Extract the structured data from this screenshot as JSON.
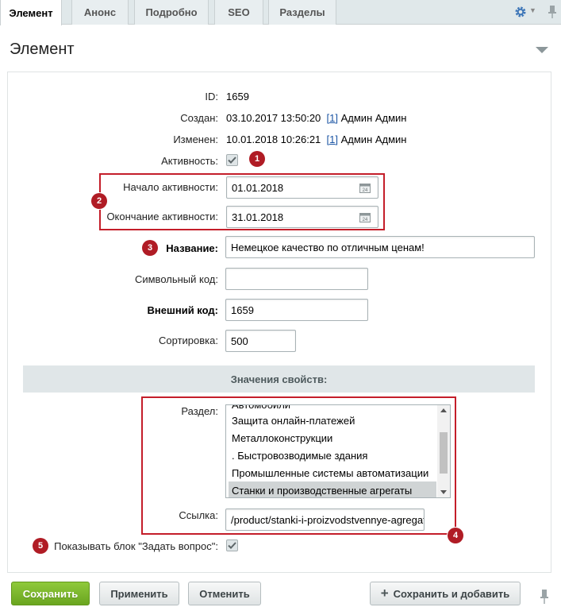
{
  "tabs": [
    {
      "label": "Элемент",
      "active": true
    },
    {
      "label": "Анонс",
      "active": false
    },
    {
      "label": "Подробно",
      "active": false
    },
    {
      "label": "SEO",
      "active": false
    },
    {
      "label": "Разделы",
      "active": false
    }
  ],
  "section_title": "Элемент",
  "fields": {
    "id": {
      "label": "ID:",
      "value": "1659"
    },
    "created": {
      "label": "Создан:",
      "value": "03.10.2017 13:50:20",
      "user_link": "[1]",
      "user_name": "Админ Админ"
    },
    "modified": {
      "label": "Изменен:",
      "value": "10.01.2018 10:26:21",
      "user_link": "[1]",
      "user_name": "Админ Админ"
    },
    "active": {
      "label": "Активность:",
      "checked": true
    },
    "active_from": {
      "label": "Начало активности:",
      "value": "01.01.2018"
    },
    "active_to": {
      "label": "Окончание активности:",
      "value": "31.01.2018"
    },
    "name": {
      "label": "Название:",
      "value": "Немецкое качество по отличным ценам!"
    },
    "code": {
      "label": "Символьный код:",
      "value": ""
    },
    "xml_id": {
      "label": "Внешний код:",
      "value": "1659"
    },
    "sort": {
      "label": "Сортировка:",
      "value": "500"
    }
  },
  "properties": {
    "header": "Значения свойств:",
    "section_label": "Раздел:",
    "section_options": [
      "Автомобили",
      "Защита онлайн-платежей",
      "Металлоконструкции",
      ". Быстровозводимые здания",
      "Промышленные системы автоматизации",
      "Станки и производственные агрегаты"
    ],
    "selected_option": "Станки и производственные агрегаты",
    "link_label": "Ссылка:",
    "link_value": "/product/stanki-i-proizvodstvennye-agregaty/",
    "ask_block_label": "Показывать блок \"Задать вопрос\":",
    "ask_block_checked": true
  },
  "badges": [
    "1",
    "2",
    "3",
    "4",
    "5"
  ],
  "buttons": {
    "save": "Сохранить",
    "apply": "Применить",
    "cancel": "Отменить",
    "save_add": "Сохранить и добавить"
  },
  "colors": {
    "annotation_red": "#b01c25",
    "save_green": "#7ab72e",
    "link_blue": "#1b55a4",
    "gear_blue": "#3f77b8"
  },
  "icons": [
    "gear-icon",
    "pin-icon",
    "calendar-icon",
    "checkmark-icon",
    "plus-icon",
    "collapse-arrow-icon"
  ]
}
